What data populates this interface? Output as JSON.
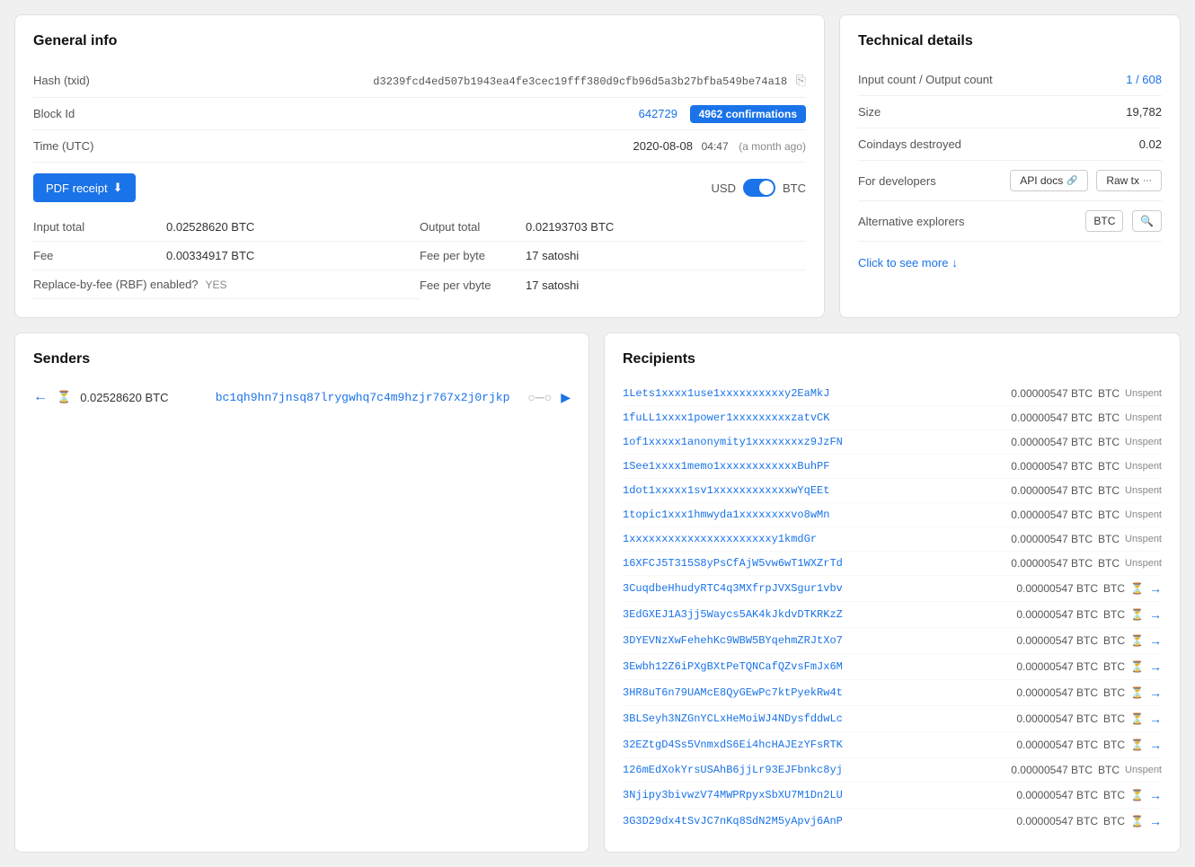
{
  "general_info": {
    "title": "General info",
    "hash_label": "Hash (txid)",
    "hash_value": "d3239fcd4ed507b1943ea4fe3cec19fff380d9cfb96d5a3b27bfba549be74a18",
    "block_id_label": "Block Id",
    "block_id_value": "642729",
    "confirmations": "4962 confirmations",
    "time_label": "Time (UTC)",
    "time_value": "2020-08-08",
    "time_hm": "04:47",
    "time_ago": "(a month ago)",
    "pdf_btn": "PDF receipt",
    "currency_usd": "USD",
    "currency_btc": "BTC",
    "input_total_label": "Input total",
    "input_total_value": "0.02528620 BTC",
    "output_total_label": "Output total",
    "output_total_value": "0.02193703 BTC",
    "fee_label": "Fee",
    "fee_value": "0.00334917 BTC",
    "fee_per_byte_label": "Fee per byte",
    "fee_per_byte_value": "17 satoshi",
    "rbf_label": "Replace-by-fee (RBF) enabled?",
    "rbf_value": "YES",
    "fee_per_vbyte_label": "Fee per vbyte",
    "fee_per_vbyte_value": "17 satoshi"
  },
  "technical_details": {
    "title": "Technical details",
    "input_output_label": "Input count / Output count",
    "input_output_value": "1 / 608",
    "size_label": "Size",
    "size_value": "19,782",
    "coindays_label": "Coindays destroyed",
    "coindays_value": "0.02",
    "for_developers_label": "For developers",
    "api_docs_btn": "API docs",
    "raw_tx_btn": "Raw tx",
    "alt_explorers_label": "Alternative explorers",
    "btc_btn": "BTC",
    "click_more": "Click to see more"
  },
  "senders": {
    "title": "Senders",
    "items": [
      {
        "amount": "0.02528620 BTC",
        "address": "bc1qh9hn7jnsq87lrygwhq7c4m9hzjr767x2j0rjkp"
      }
    ]
  },
  "recipients": {
    "title": "Recipients",
    "items": [
      {
        "address": "1Lets1xxxx1use1xxxxxxxxxxy2EaMkJ",
        "amount": "0.00000547 BTC",
        "status": "Unspent"
      },
      {
        "address": "1fuLL1xxxx1power1xxxxxxxxxzatvCK",
        "amount": "0.00000547 BTC",
        "status": "Unspent"
      },
      {
        "address": "1of1xxxxx1anonymity1xxxxxxxxz9JzFN",
        "amount": "0.00000547 BTC",
        "status": "Unspent"
      },
      {
        "address": "1See1xxxx1memo1xxxxxxxxxxxxBuhPF",
        "amount": "0.00000547 BTC",
        "status": "Unspent"
      },
      {
        "address": "1dot1xxxxx1sv1xxxxxxxxxxxxwYqEEt",
        "amount": "0.00000547 BTC",
        "status": "Unspent"
      },
      {
        "address": "1topic1xxx1hmwyda1xxxxxxxxvo8wMn",
        "amount": "0.00000547 BTC",
        "status": "Unspent"
      },
      {
        "address": "1xxxxxxxxxxxxxxxxxxxxxxy1kmdGr",
        "amount": "0.00000547 BTC",
        "status": "Unspent"
      },
      {
        "address": "16XFCJ5T315S8yPsCfAjW5vw6wT1WXZrTd",
        "amount": "0.00000547 BTC",
        "status": "Unspent"
      },
      {
        "address": "3CuqdbeHhudyRTC4q3MXfrpJVXSgur1vbv",
        "amount": "0.00000547 BTC",
        "status": "spent"
      },
      {
        "address": "3EdGXEJ1A3jj5Waycs5AK4kJkdvDTKRKzZ",
        "amount": "0.00000547 BTC",
        "status": "spent"
      },
      {
        "address": "3DYEVNzXwFehehKc9WBW5BYqehmZRJtXo7",
        "amount": "0.00000547 BTC",
        "status": "spent"
      },
      {
        "address": "3Ewbh12Z6iPXgBXtPeTQNCafQZvsFmJx6M",
        "amount": "0.00000547 BTC",
        "status": "spent"
      },
      {
        "address": "3HR8uT6n79UAMcE8QyGEwPc7ktPyekRw4t",
        "amount": "0.00000547 BTC",
        "status": "spent"
      },
      {
        "address": "3BLSeyh3NZGnYCLxHeMoiWJ4NDysfddwLc",
        "amount": "0.00000547 BTC",
        "status": "spent"
      },
      {
        "address": "32EZtgD4Ss5VnmxdS6Ei4hcHAJEzYFsRTK",
        "amount": "0.00000547 BTC",
        "status": "spent"
      },
      {
        "address": "126mEdXokYrsUSAhB6jjLr93EJFbnkc8yj",
        "amount": "0.00000547 BTC",
        "status": "Unspent"
      },
      {
        "address": "3Njipy3bivwzV74MWPRpyxSbXU7M1Dn2LU",
        "amount": "0.00000547 BTC",
        "status": "spent"
      },
      {
        "address": "3G3D29dx4tSvJC7nKq8SdN2M5yApvj6AnP",
        "amount": "0.00000547 BTC",
        "status": "spent"
      }
    ]
  }
}
